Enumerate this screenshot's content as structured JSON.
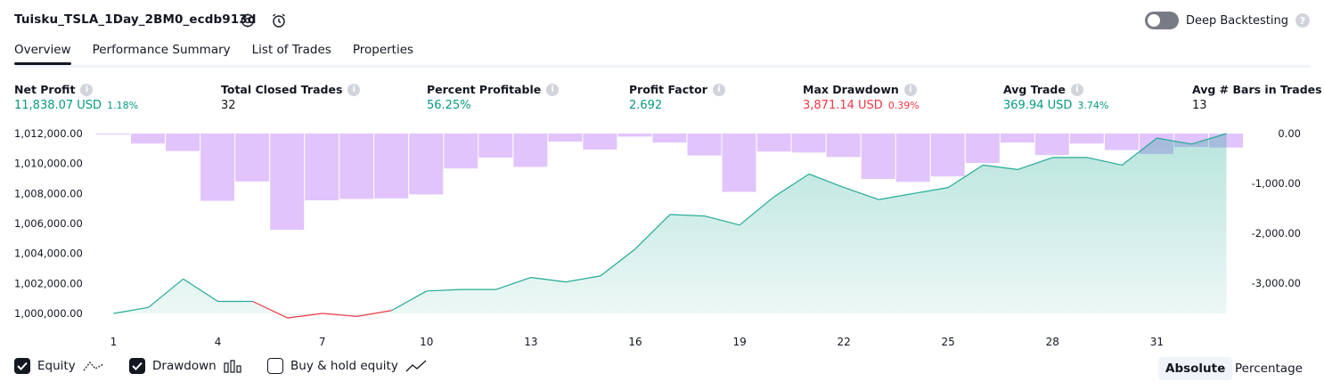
{
  "header": {
    "title": "Tuisku_TSLA_1Day_2BM0_ecdb913d",
    "deep_backtesting_label": "Deep Backtesting"
  },
  "tabs": [
    {
      "label": "Overview"
    },
    {
      "label": "Performance Summary"
    },
    {
      "label": "List of Trades"
    },
    {
      "label": "Properties"
    }
  ],
  "metrics": {
    "net_profit": {
      "label": "Net Profit",
      "value": "11,838.07 USD",
      "pct": "1.18%"
    },
    "total_closed_trades": {
      "label": "Total Closed Trades",
      "value": "32"
    },
    "percent_profitable": {
      "label": "Percent Profitable",
      "value": "56.25%"
    },
    "profit_factor": {
      "label": "Profit Factor",
      "value": "2.692"
    },
    "max_drawdown": {
      "label": "Max Drawdown",
      "value": "3,871.14 USD",
      "pct": "0.39%"
    },
    "avg_trade": {
      "label": "Avg Trade",
      "value": "369.94 USD",
      "pct": "3.74%"
    },
    "avg_bars": {
      "label": "Avg # Bars in Trades",
      "value": "13"
    }
  },
  "legend": {
    "equity_label": "Equity",
    "drawdown_label": "Drawdown",
    "buy_hold_label": "Buy & hold equity"
  },
  "view_toggle": {
    "absolute_label": "Absolute",
    "percentage_label": "Percentage"
  },
  "colors": {
    "equity_line": "#22ab94",
    "equity_loss": "#f23645",
    "equity_fill": "#22ab94",
    "drawdown_bar": "#e1c4fc",
    "positive": "#089981",
    "negative": "#f23645"
  },
  "chart_data": {
    "type": "area",
    "x_ticks": [
      "1",
      "4",
      "7",
      "10",
      "13",
      "16",
      "19",
      "22",
      "25",
      "28",
      "31"
    ],
    "left_ticks": [
      "1,012,000.00",
      "1,010,000.00",
      "1,008,000.00",
      "1,006,000.00",
      "1,004,000.00",
      "1,002,000.00",
      "1,000,000.00"
    ],
    "right_ticks": [
      "0.00",
      "-1,000.00",
      "-2,000.00",
      "-3,000.00"
    ],
    "left_ylim": [
      1000000,
      1012000
    ],
    "right_ylim": [
      -3750,
      0
    ],
    "series": [
      {
        "name": "Equity",
        "x": [
          1,
          2,
          3,
          4,
          5,
          6,
          7,
          8,
          9,
          10,
          11,
          12,
          13,
          14,
          15,
          16,
          17,
          18,
          19,
          20,
          21,
          22,
          23,
          24,
          25,
          26,
          27,
          28,
          29,
          30,
          31,
          32,
          33
        ],
        "values": [
          1000000,
          1000400,
          1002300,
          1000800,
          1000800,
          999700,
          1000000,
          999800,
          1000200,
          1001500,
          1001600,
          1001600,
          1002400,
          1002100,
          1002500,
          1004300,
          1006600,
          1006500,
          1005900,
          1007800,
          1009300,
          1008400,
          1007600,
          1008000,
          1008400,
          1009900,
          1009600,
          1010400,
          1010400,
          1009900,
          1011700,
          1011300,
          1012000
        ]
      },
      {
        "name": "Drawdown",
        "x": [
          1,
          2,
          3,
          4,
          5,
          6,
          7,
          8,
          9,
          10,
          11,
          12,
          13,
          14,
          15,
          16,
          17,
          18,
          19,
          20,
          21,
          22,
          23,
          24,
          25,
          26,
          27,
          28,
          29,
          30,
          31,
          32,
          33
        ],
        "values": [
          0,
          -200,
          -350,
          -1350,
          -960,
          -1930,
          -1340,
          -1310,
          -1300,
          -1220,
          -700,
          -480,
          -670,
          -160,
          -320,
          -60,
          -180,
          -440,
          -1170,
          -360,
          -380,
          -470,
          -910,
          -970,
          -860,
          -590,
          -180,
          -430,
          -200,
          -330,
          -410,
          -270,
          -280
        ]
      }
    ]
  }
}
